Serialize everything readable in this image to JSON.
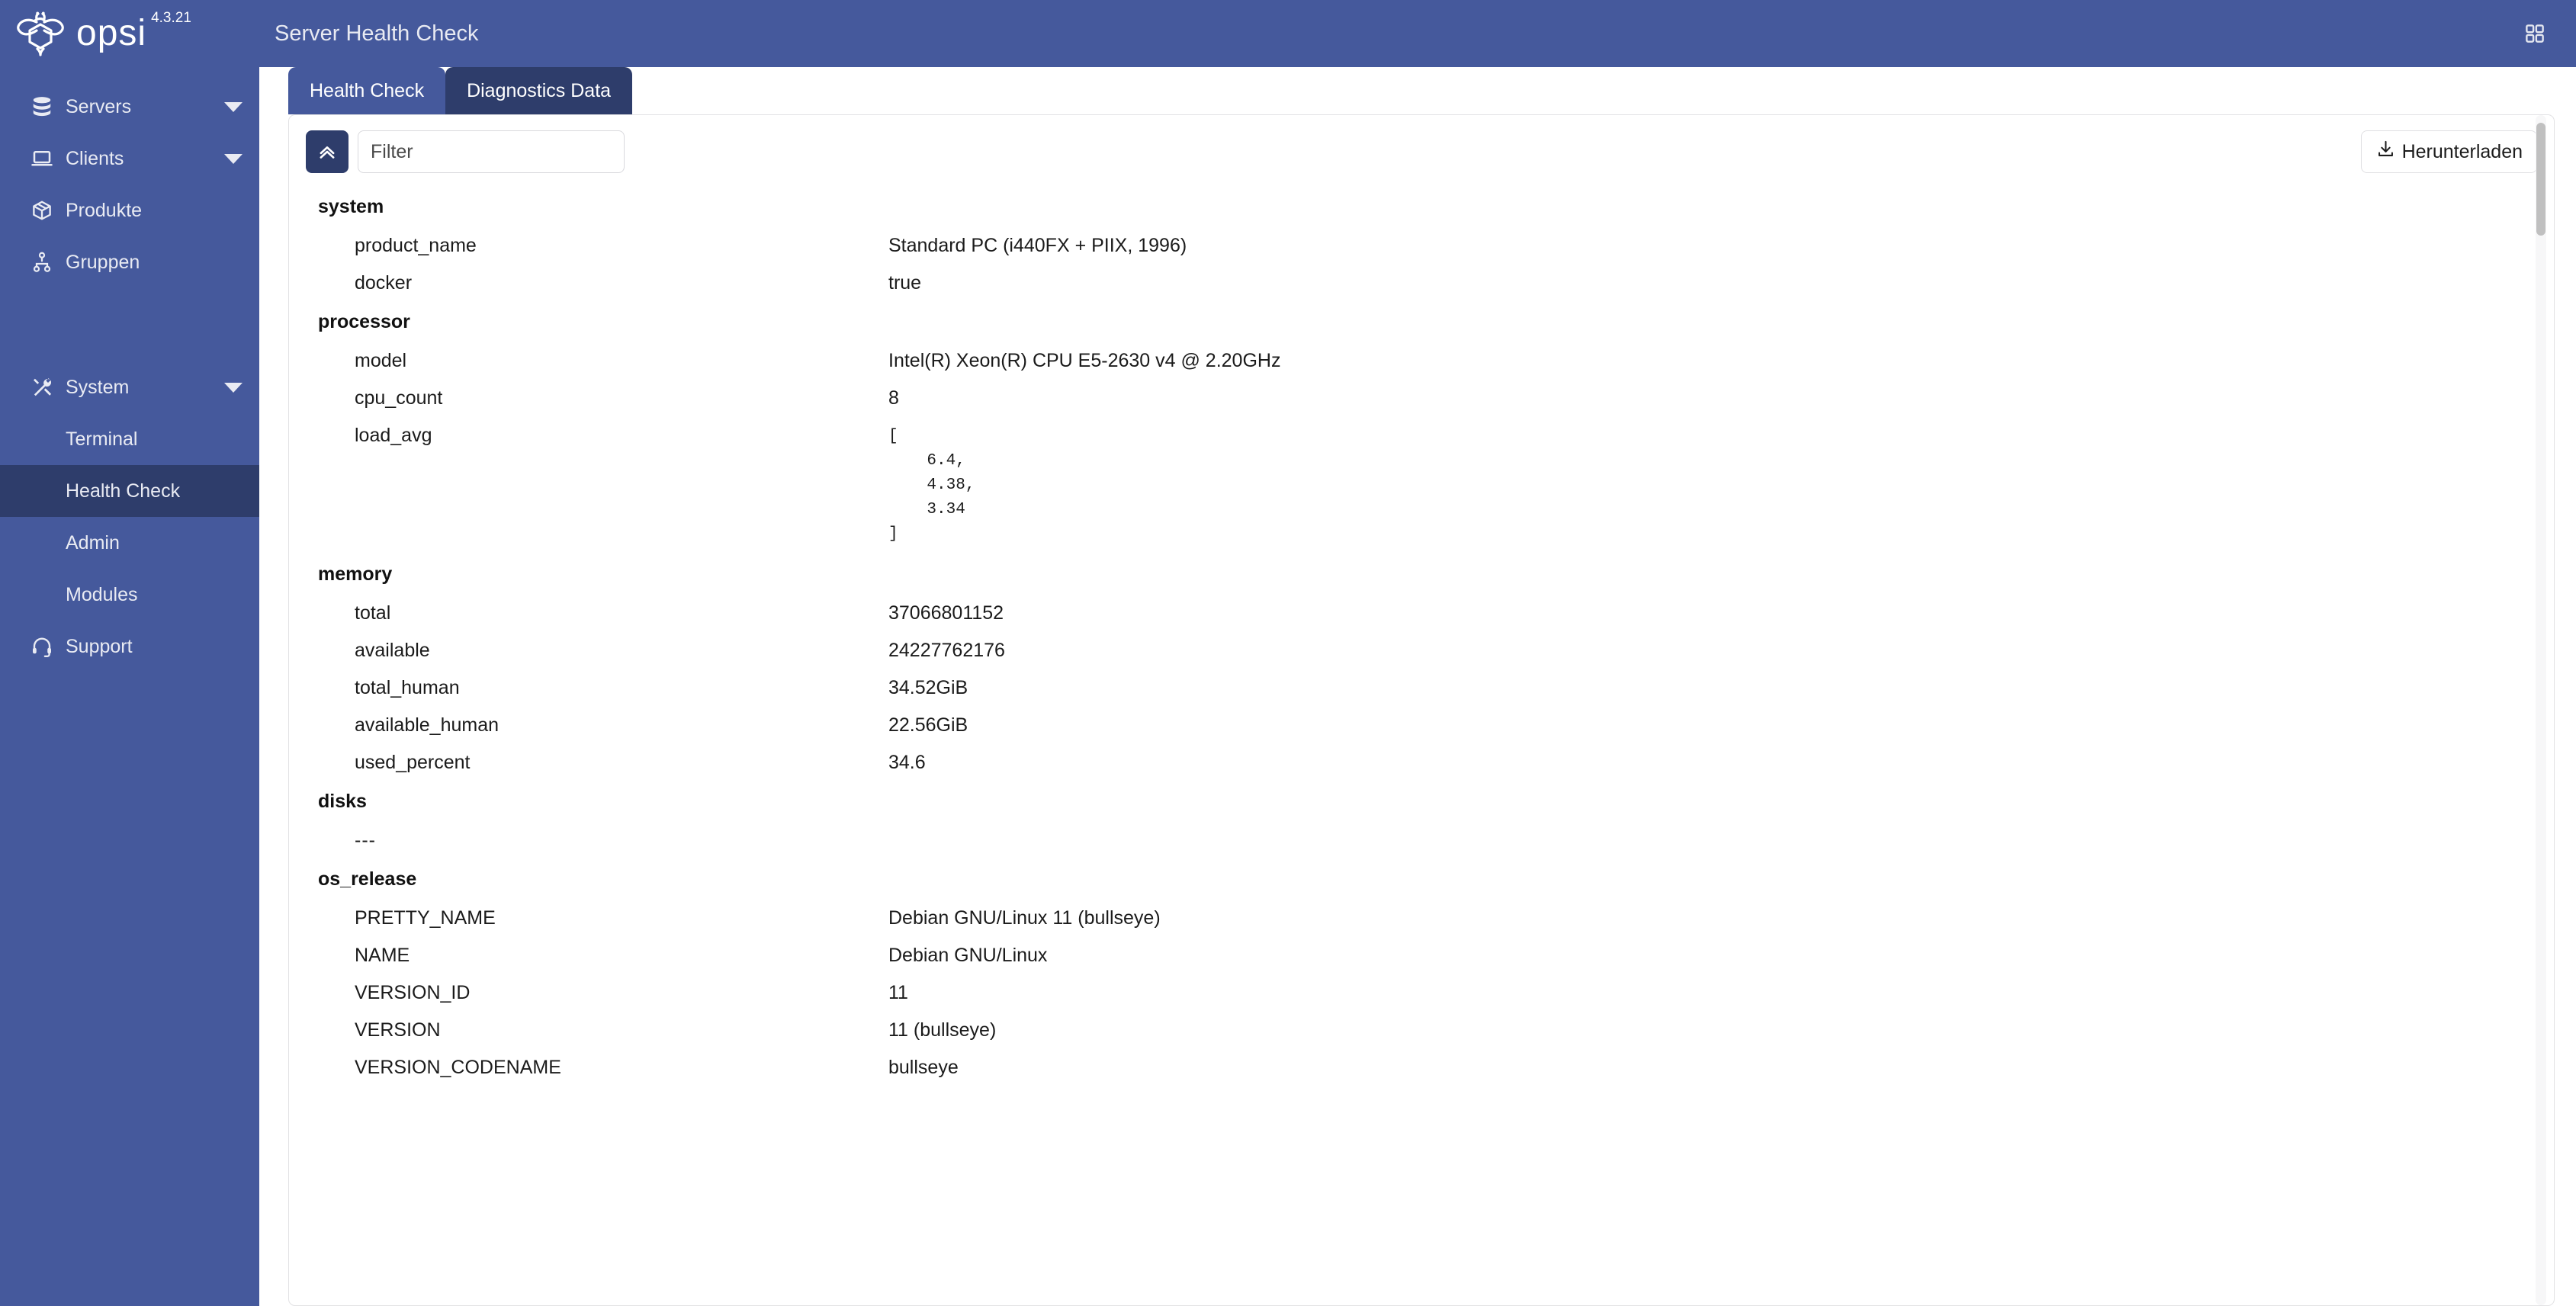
{
  "brand": {
    "name": "opsi",
    "version": "4.3.21",
    "logo_icon": "bee-hexagon-logo"
  },
  "header": {
    "title": "Server Health Check",
    "apps_icon": "grid-apps-icon"
  },
  "sidebar": {
    "items": [
      {
        "label": "Servers",
        "icon": "database-icon",
        "caret": true,
        "sub": false,
        "active": false
      },
      {
        "label": "Clients",
        "icon": "laptop-icon",
        "caret": true,
        "sub": false,
        "active": false
      },
      {
        "label": "Produkte",
        "icon": "box-icon",
        "caret": false,
        "sub": false,
        "active": false
      },
      {
        "label": "Gruppen",
        "icon": "sitemap-icon",
        "caret": false,
        "sub": false,
        "active": false
      },
      {
        "label": "System",
        "icon": "tools-icon",
        "caret": true,
        "sub": false,
        "active": false
      },
      {
        "label": "Terminal",
        "icon": "",
        "caret": false,
        "sub": true,
        "active": false
      },
      {
        "label": "Health Check",
        "icon": "",
        "caret": false,
        "sub": true,
        "active": true
      },
      {
        "label": "Admin",
        "icon": "",
        "caret": false,
        "sub": true,
        "active": false
      },
      {
        "label": "Modules",
        "icon": "",
        "caret": false,
        "sub": true,
        "active": false
      },
      {
        "label": "Support",
        "icon": "headset-icon",
        "caret": false,
        "sub": false,
        "active": false
      }
    ]
  },
  "tabs": [
    {
      "label": "Health Check",
      "active": false
    },
    {
      "label": "Diagnostics Data",
      "active": true
    }
  ],
  "toolbar": {
    "collapse_icon": "chevron-double-up-icon",
    "filter_value": "",
    "filter_placeholder": "Filter",
    "download_label": "Herunterladen",
    "download_icon": "download-icon"
  },
  "diagnostics": [
    {
      "group": "system",
      "rows": [
        {
          "key": "product_name",
          "value": "Standard PC (i440FX + PIIX, 1996)",
          "mono": false
        },
        {
          "key": "docker",
          "value": "true",
          "mono": false
        }
      ]
    },
    {
      "group": "processor",
      "rows": [
        {
          "key": "model",
          "value": "Intel(R) Xeon(R) CPU E5-2630 v4 @ 2.20GHz",
          "mono": false
        },
        {
          "key": "cpu_count",
          "value": "8",
          "mono": false
        },
        {
          "key": "load_avg",
          "value": "[\n    6.4,\n    4.38,\n    3.34\n]",
          "mono": true
        }
      ]
    },
    {
      "group": "memory",
      "rows": [
        {
          "key": "total",
          "value": "37066801152",
          "mono": false
        },
        {
          "key": "available",
          "value": "24227762176",
          "mono": false
        },
        {
          "key": "total_human",
          "value": "34.52GiB",
          "mono": false
        },
        {
          "key": "available_human",
          "value": "22.56GiB",
          "mono": false
        },
        {
          "key": "used_percent",
          "value": "34.6",
          "mono": false
        }
      ]
    },
    {
      "group": "disks",
      "placeholder": "---",
      "rows": []
    },
    {
      "group": "os_release",
      "rows": [
        {
          "key": "PRETTY_NAME",
          "value": "Debian GNU/Linux 11 (bullseye)",
          "mono": false
        },
        {
          "key": "NAME",
          "value": "Debian GNU/Linux",
          "mono": false
        },
        {
          "key": "VERSION_ID",
          "value": "11",
          "mono": false
        },
        {
          "key": "VERSION",
          "value": "11 (bullseye)",
          "mono": false
        },
        {
          "key": "VERSION_CODENAME",
          "value": "bullseye",
          "mono": false
        }
      ]
    }
  ],
  "colors": {
    "brand_blue": "#45599c",
    "active_navy": "#2e3d6b",
    "page_bg": "#ffffff",
    "text_dark": "#1b1b1b",
    "scrollbar_thumb": "#c0c0c0"
  }
}
